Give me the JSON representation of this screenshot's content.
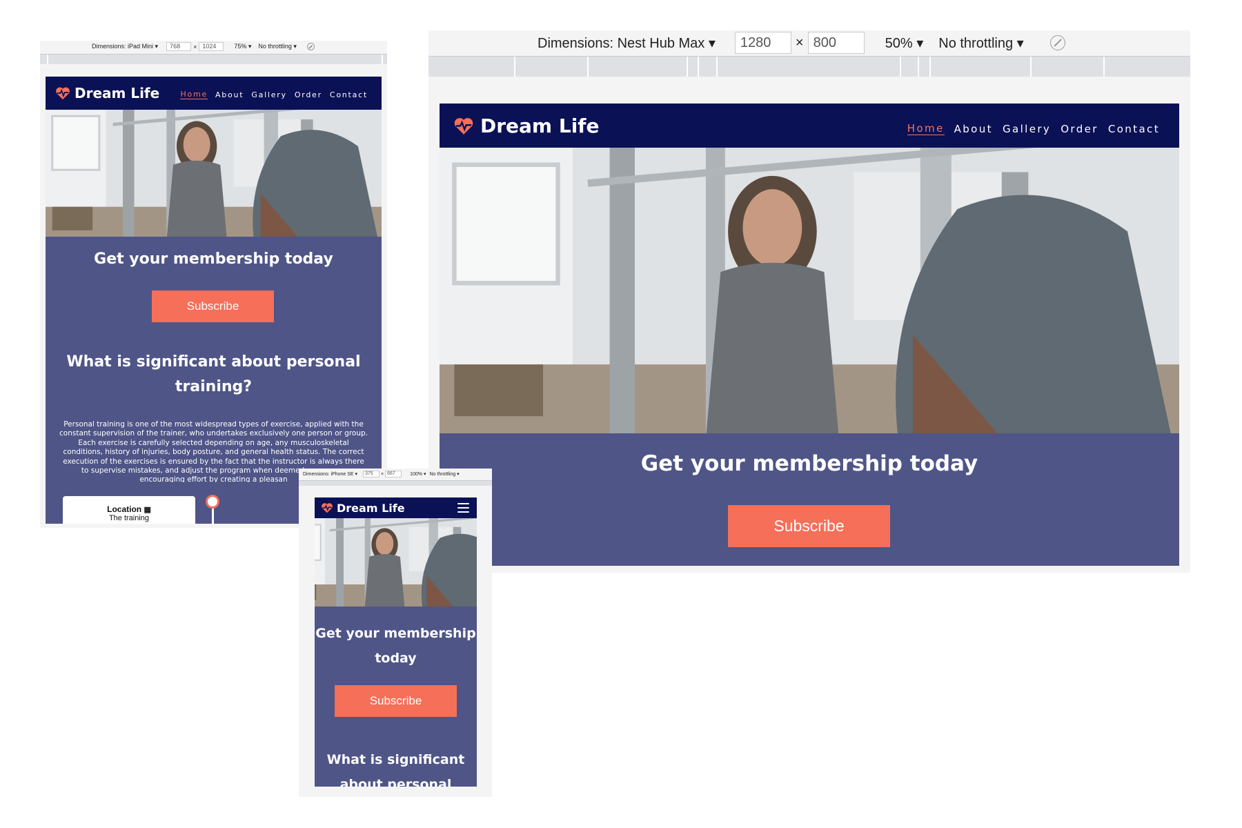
{
  "site": {
    "brand": "Dream Life",
    "nav": [
      "Home",
      "About",
      "Gallery",
      "Order",
      "Contact"
    ],
    "active_nav": "Home",
    "hero_heading": "Get your membership today",
    "subscribe_label": "Subscribe",
    "section_heading": "What is significant about personal training?",
    "section_heading_mobile_visible": "What is significant about personal",
    "body_text": "Personal training is one of the most widespread types of exercise, applied with the constant supervision of the trainer, who undertakes exclusively one person or group. Each exercise is carefully selected depending on age, any musculoskeletal conditions, history of injuries, body posture, and general health status. The correct execution of the exercises is ensured by the fact that the instructor is always there to supervise mistakes, and adjust the program when deemed necessary, encouraging effort by creating a pleasan",
    "location_title": "Location",
    "location_sub": "The training",
    "colors": {
      "header_bg": "#0b1155",
      "content_bg": "#4f5587",
      "accent": "#f56f59",
      "text": "#ffffff"
    },
    "icons": [
      "heart-pulse-icon",
      "map-icon",
      "hamburger-menu-icon"
    ]
  },
  "devtools": {
    "ipad": {
      "device": "Dimensions: iPad Mini",
      "width": "768",
      "height": "1024",
      "zoom": "75%",
      "throttling": "No throttling"
    },
    "nest": {
      "device": "Dimensions: Nest Hub Max",
      "width": "1280",
      "height": "800",
      "zoom": "50%",
      "throttling": "No throttling"
    },
    "iphone": {
      "device": "Dimensions: iPhone SE",
      "width": "375",
      "height": "667",
      "zoom": "100%",
      "throttling": "No throttling"
    }
  }
}
